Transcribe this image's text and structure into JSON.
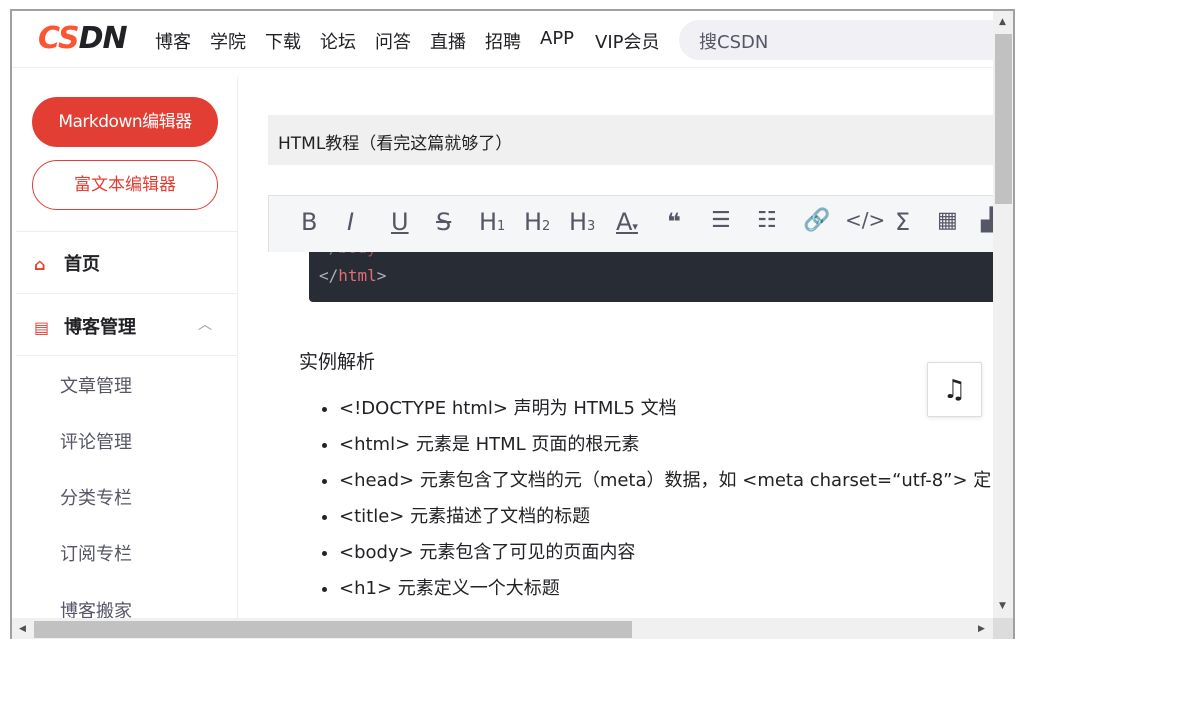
{
  "brand": {
    "logo_prefix": "CS",
    "logo_suffix": "DN",
    "accent": "#fc5531",
    "red": "#e33e33"
  },
  "nav": {
    "links": [
      "博客",
      "学院",
      "下载",
      "论坛",
      "问答",
      "直播",
      "招聘",
      "APP",
      "VIP会员"
    ],
    "search_placeholder": "搜CSDN"
  },
  "sidebar": {
    "markdown_btn": "Markdown编辑器",
    "richtext_btn": "富文本编辑器",
    "home": {
      "icon": "home-icon",
      "label": "首页"
    },
    "blog_manage": {
      "icon": "document-icon",
      "label": "博客管理",
      "expanded": true
    },
    "sub_items": [
      "文章管理",
      "评论管理",
      "分类专栏",
      "订阅专栏",
      "博客搬家"
    ]
  },
  "editor": {
    "title": "HTML教程（看完这篇就够了）",
    "toolbar": [
      "bold-icon",
      "italic-icon",
      "underline-icon",
      "strikethrough-icon",
      "h1-icon",
      "h2-icon",
      "h3-icon",
      "font-color-icon",
      "quote-icon",
      "ordered-list-icon",
      "unordered-list-icon",
      "link-icon",
      "code-icon",
      "sum-icon",
      "table-icon"
    ],
    "code": {
      "line1_open": "</",
      "line1_tag": "body",
      "line1_close": ">",
      "line2_open": "</",
      "line2_tag": "html",
      "line2_close": ">"
    },
    "section_heading": "实例解析",
    "bullets": [
      "<!DOCTYPE html> 声明为 HTML5 文档",
      "<html> 元素是 HTML 页面的根元素",
      "<head> 元素包含了文档的元（meta）数据，如 <meta charset=“utf-8”> 定",
      "<title> 元素描述了文档的标题",
      "<body> 元素包含了可见的页面内容",
      "<h1> 元素定义一个大标题"
    ]
  }
}
